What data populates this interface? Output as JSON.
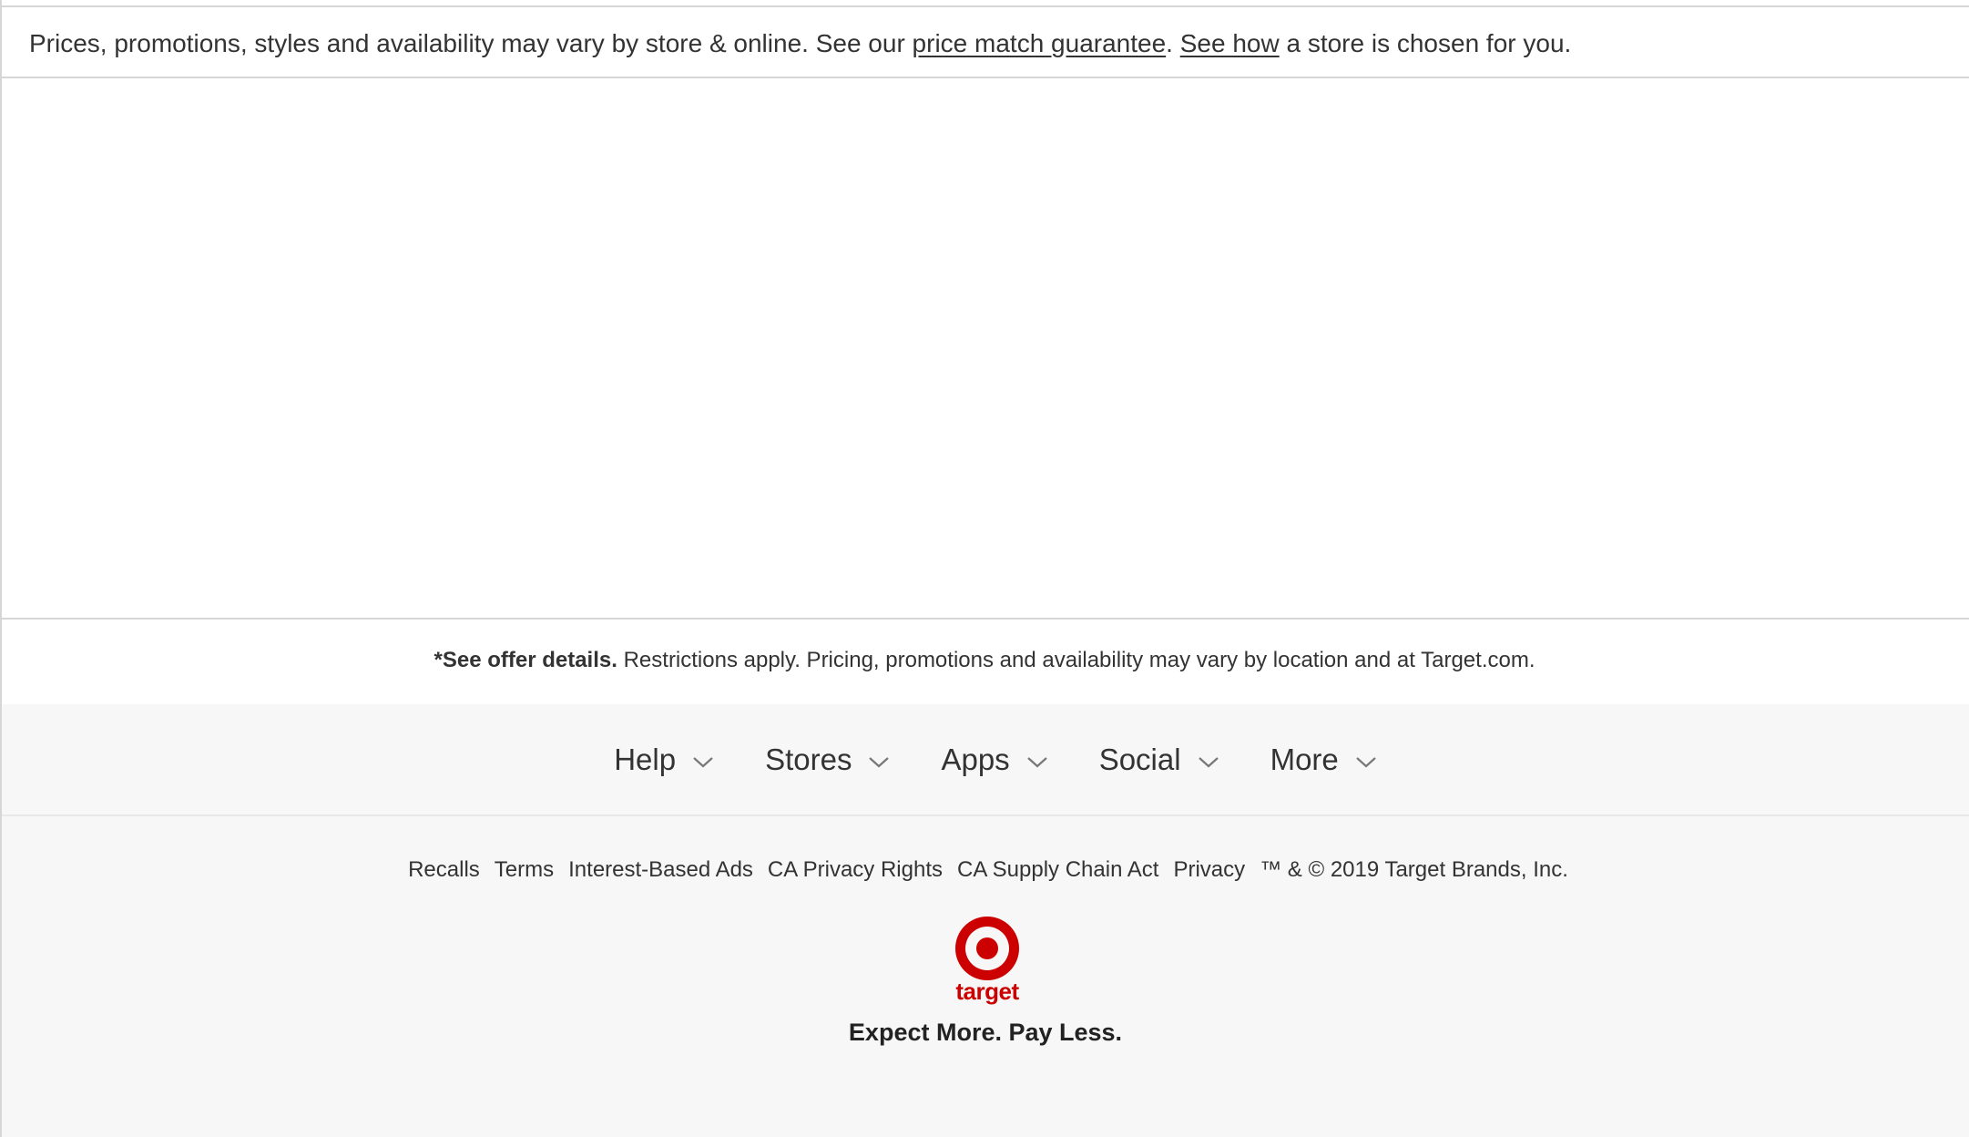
{
  "notice": {
    "text_before": "Prices, promotions, styles and availability may vary by store & online. See our ",
    "price_match_link": "price match guarantee",
    "text_middle": ". ",
    "see_how_link": "See how",
    "text_after": " a store is chosen for you."
  },
  "offer": {
    "bold": "*See offer details.",
    "text": " Restrictions apply. Pricing, promotions and availability may vary by location and at Target.com."
  },
  "footer_menu": [
    {
      "label": "Help",
      "icon": "chevron-down-icon"
    },
    {
      "label": "Stores",
      "icon": "chevron-down-icon"
    },
    {
      "label": "Apps",
      "icon": "chevron-down-icon"
    },
    {
      "label": "Social",
      "icon": "chevron-down-icon"
    },
    {
      "label": "More",
      "icon": "chevron-down-icon"
    }
  ],
  "legal": {
    "links": [
      "Recalls",
      "Terms",
      "Interest-Based Ads",
      "CA Privacy Rights",
      "CA Supply Chain Act",
      "Privacy"
    ],
    "copyright": "™ & © 2019 Target Brands, Inc."
  },
  "brand": {
    "logo_icon": "target-bullseye-icon",
    "wordmark": "target",
    "tagline": "Expect More. Pay Less.",
    "color": "#cc0000"
  }
}
